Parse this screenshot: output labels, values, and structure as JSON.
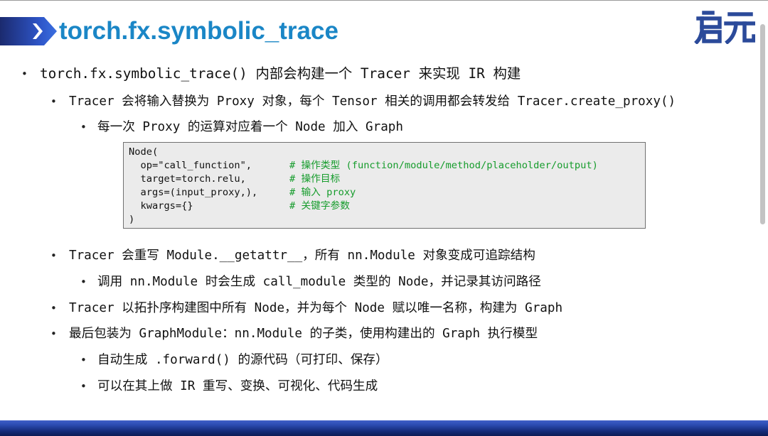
{
  "slide": {
    "title": "torch.fx.symbolic_trace",
    "logo_text": "启元",
    "accent_color": "#1a86c6",
    "banner_color": "#2e55c8"
  },
  "bullets": [
    {
      "level": 1,
      "text": "torch.fx.symbolic_trace() 内部会构建一个 Tracer 来实现 IR 构建"
    },
    {
      "level": 2,
      "text": "Tracer 会将输入替换为 Proxy 对象，每个 Tensor 相关的调用都会转发给 Tracer.create_proxy()"
    },
    {
      "level": 3,
      "text": "每一次 Proxy 的运算对应着一个 Node 加入 Graph"
    },
    {
      "level": 2,
      "text": "Tracer 会重写 Module.__getattr__，所有 nn.Module 对象变成可追踪结构"
    },
    {
      "level": 3,
      "text": "调用 nn.Module 时会生成 call_module 类型的 Node，并记录其访问路径"
    },
    {
      "level": 2,
      "text": "Tracer 以拓扑序构建图中所有 Node，并为每个 Node 赋以唯一名称，构建为 Graph"
    },
    {
      "level": 2,
      "text": "最后包装为 GraphModule：nn.Module 的子类，使用构建出的 Graph 执行模型"
    },
    {
      "level": 3,
      "text": "自动生成 .forward() 的源代码（可打印、保存）"
    },
    {
      "level": 3,
      "text": "可以在其上做 IR 重写、变换、可视化、代码生成"
    }
  ],
  "code_block": {
    "lines": [
      {
        "code": "Node(",
        "comment": ""
      },
      {
        "code": "  op=\"call_function\",",
        "comment": "# 操作类型 (function/module/method/placeholder/output)"
      },
      {
        "code": "  target=torch.relu,",
        "comment": "# 操作目标"
      },
      {
        "code": "  args=(input_proxy,),",
        "comment": "# 输入 proxy"
      },
      {
        "code": "  kwargs={}",
        "comment": "# 关键字参数"
      },
      {
        "code": ")",
        "comment": ""
      }
    ]
  },
  "bullet_glyph": "•"
}
